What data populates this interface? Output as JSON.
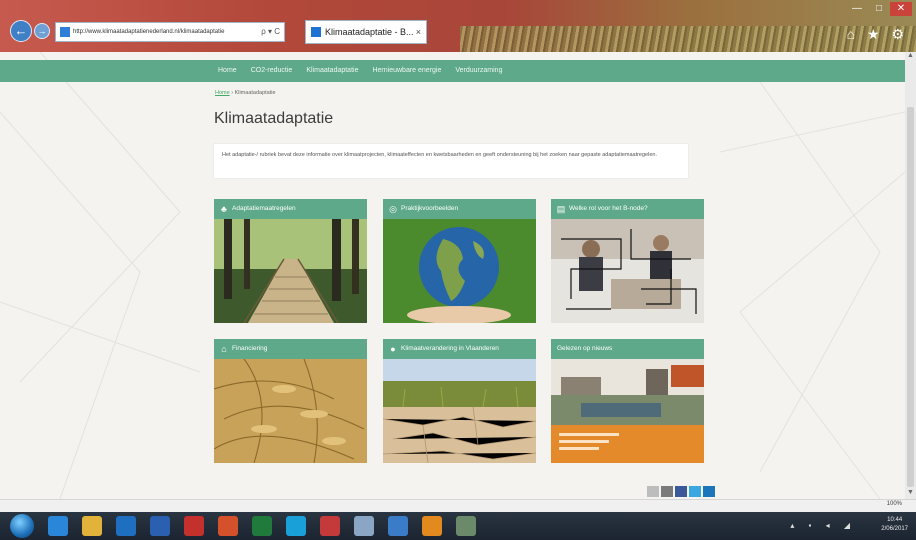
{
  "browser": {
    "address": "http://www.klimaatadaptatienederland.nl/klimaatadaptatie",
    "search_glyph": "ρ ▾ C",
    "tab_title": "Klimaatadaptatie - B...",
    "tab_close": "×",
    "window_controls": [
      "—",
      "□",
      "✕"
    ],
    "toolbar_glyphs": "⌂ ★ ⚙"
  },
  "nav": {
    "items": [
      "Home",
      "CO2-reductie",
      "Klimaatadaptatie",
      "Hernieuwbare energie",
      "Verduurzaming"
    ]
  },
  "breadcrumb": {
    "home": "Home",
    "separator": " › ",
    "current": "Klimaatadaptatie"
  },
  "page_title": "Klimaatadaptatie",
  "intro_text": "Het adaptatie-/ rubriek bevat deze informatie over klimaatprojecten, klimaateffecten en kwetsbaarheden en geeft ondersteuning bij het zoeken naar gepaste adaptatiemaatregelen.",
  "tiles": [
    {
      "label": "Adaptatiemaatregelen",
      "icon": "tree-icon"
    },
    {
      "label": "Praktijkvoorbeelden",
      "icon": "globe-icon"
    },
    {
      "label": "Welke rol voor het B-node?",
      "icon": "document-icon"
    },
    {
      "label": "Financiering",
      "icon": "bank-icon"
    },
    {
      "label": "Klimaatverandering in Vlaanderen",
      "icon": "location-icon"
    },
    {
      "label": "Gelezen op nieuws",
      "icon": ""
    }
  ],
  "status": {
    "zoom": "100%"
  },
  "clock": {
    "time": "10:44",
    "date": "2/06/2017"
  },
  "colors": {
    "accent": "#5ea98a",
    "chrome": "#b24839"
  }
}
